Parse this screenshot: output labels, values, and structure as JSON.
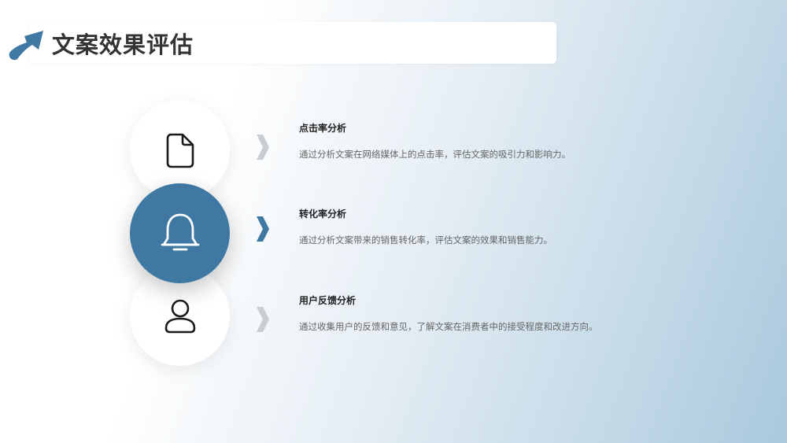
{
  "header": {
    "title": "文案效果评估"
  },
  "colors": {
    "accent": "#3e78a3",
    "chevron_inactive": "#c9ccd0",
    "chevron_active": "#3e78a3"
  },
  "items": [
    {
      "icon": "document-icon",
      "title": "点击率分析",
      "description": "通过分析文案在网络媒体上的点击率，评估文案的吸引力和影响力。",
      "active": false
    },
    {
      "icon": "bell-icon",
      "title": "转化率分析",
      "description": "通过分析文案带来的销售转化率，评估文案的效果和销售能力。",
      "active": true
    },
    {
      "icon": "user-icon",
      "title": "用户反馈分析",
      "description": "通过收集用户的反馈和意见，了解文案在消费者中的接受程度和改进方向。",
      "active": false
    }
  ]
}
